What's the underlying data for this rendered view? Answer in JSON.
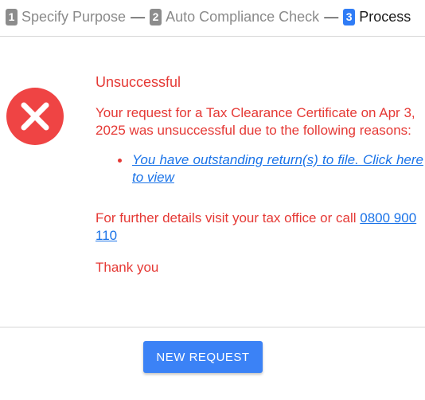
{
  "stepper": {
    "steps": [
      {
        "number": "1",
        "label": "Specify Purpose",
        "state": "done"
      },
      {
        "number": "2",
        "label": "Auto Compliance Check",
        "state": "done"
      },
      {
        "number": "3",
        "label": "Process",
        "state": "active"
      }
    ],
    "separator": "—"
  },
  "result": {
    "icon": "error-x-circle-icon",
    "title": "Unsuccessful",
    "message": "Your request for a Tax Clearance Certificate on Apr 3, 2025 was unsuccessful due to the following reasons:",
    "reasons": [
      {
        "text": "You have outstanding return(s) to file. Click here to view"
      }
    ],
    "details_text": "For further details visit your tax office or call ",
    "phone": "0800 900 110",
    "thanks": "Thank you"
  },
  "actions": {
    "new_request_label": "NEW REQUEST"
  },
  "colors": {
    "error": "#e53935",
    "error_icon": "#ef4444",
    "link": "#1a73e8",
    "primary_button": "#3b82f6",
    "step_active": "#2f7cf6",
    "step_done": "#8c8c8c"
  }
}
